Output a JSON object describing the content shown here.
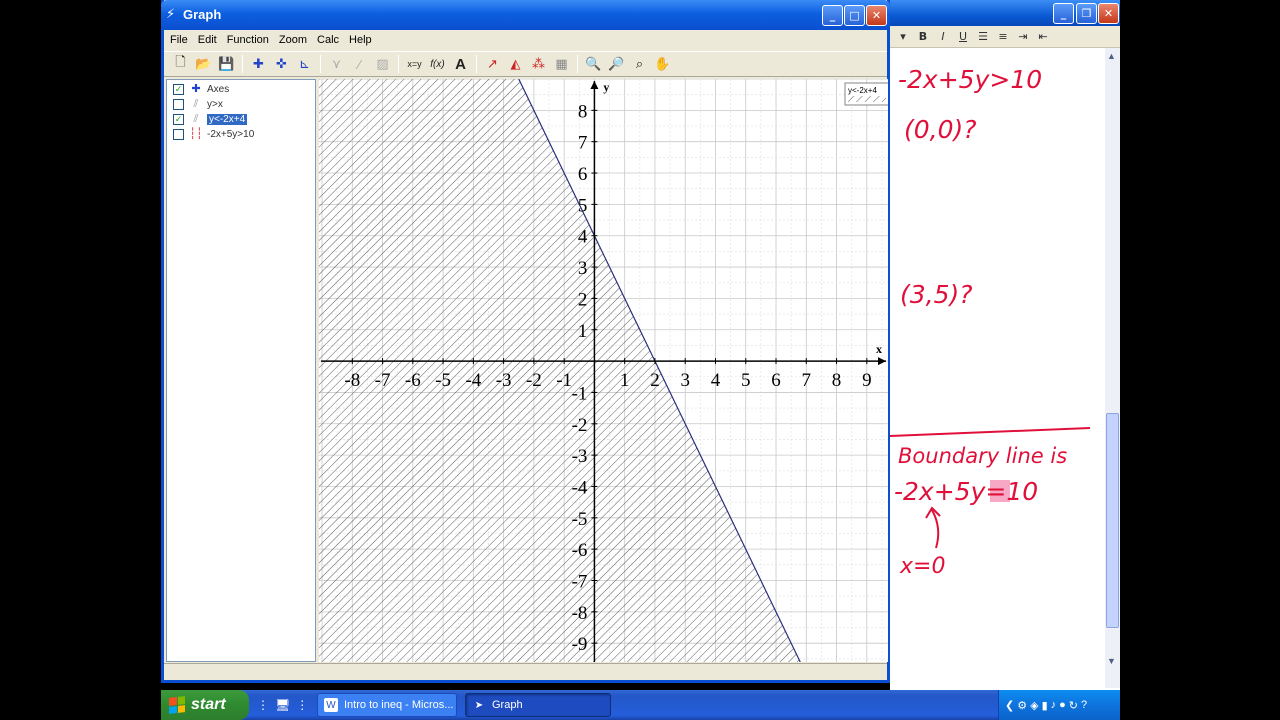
{
  "notes_window": {
    "controls": {
      "minimize": "_",
      "restore": "❐",
      "close": "✕"
    },
    "toolbar": {
      "bold": "B",
      "italic": "I",
      "underline": "U"
    },
    "handwriting": {
      "line1": "-2x+5y>10",
      "test_point_1": "(0,0)?",
      "test_point_2": "(3,5)?",
      "boundary_label": "Boundary line is",
      "boundary_eq": "-2x+5y=10",
      "x_zero": "x=0"
    },
    "ink_color": "#e0103a"
  },
  "graph_window": {
    "title": "Graph",
    "controls": {
      "minimize": "_",
      "maximize": "□",
      "close": "✕"
    },
    "menu": [
      "File",
      "Edit",
      "Function",
      "Zoom",
      "Calc",
      "Help"
    ],
    "function_list": [
      {
        "label": "Axes",
        "checked": true,
        "selected": false,
        "glyph": "axes-icon"
      },
      {
        "label": "y>x",
        "checked": false,
        "selected": false,
        "glyph": "hatch-icon"
      },
      {
        "label": "y<-2x+4",
        "checked": true,
        "selected": true,
        "glyph": "hatch-icon"
      },
      {
        "label": "-2x+5y>10",
        "checked": false,
        "selected": false,
        "glyph": "dashed-line-icon"
      }
    ],
    "plot": {
      "legend_label": "y<-2x+4",
      "x_axis_label": "x",
      "y_axis_label": "y",
      "x_range": [
        -9.1,
        9.7
      ],
      "y_range": [
        -9.6,
        9.0
      ],
      "x_ticks": [
        "-8",
        "-7",
        "-6",
        "-5",
        "-4",
        "-3",
        "-2",
        "-1",
        "1",
        "2",
        "3",
        "4",
        "5",
        "6",
        "7",
        "8",
        "9"
      ],
      "y_ticks": [
        "8",
        "7",
        "6",
        "5",
        "4",
        "3",
        "2",
        "1",
        "-1",
        "-2",
        "-3",
        "-4",
        "-5",
        "-6",
        "-7",
        "-8",
        "-9"
      ],
      "inequality": {
        "slope": -2,
        "intercept": 4,
        "shade": "below"
      },
      "line_color": "#2a2f7a",
      "grid": true
    }
  },
  "taskbar": {
    "start_label": "start",
    "tasks": [
      {
        "label": "Intro to ineq - Micros..."
      },
      {
        "label": "Graph"
      }
    ]
  }
}
